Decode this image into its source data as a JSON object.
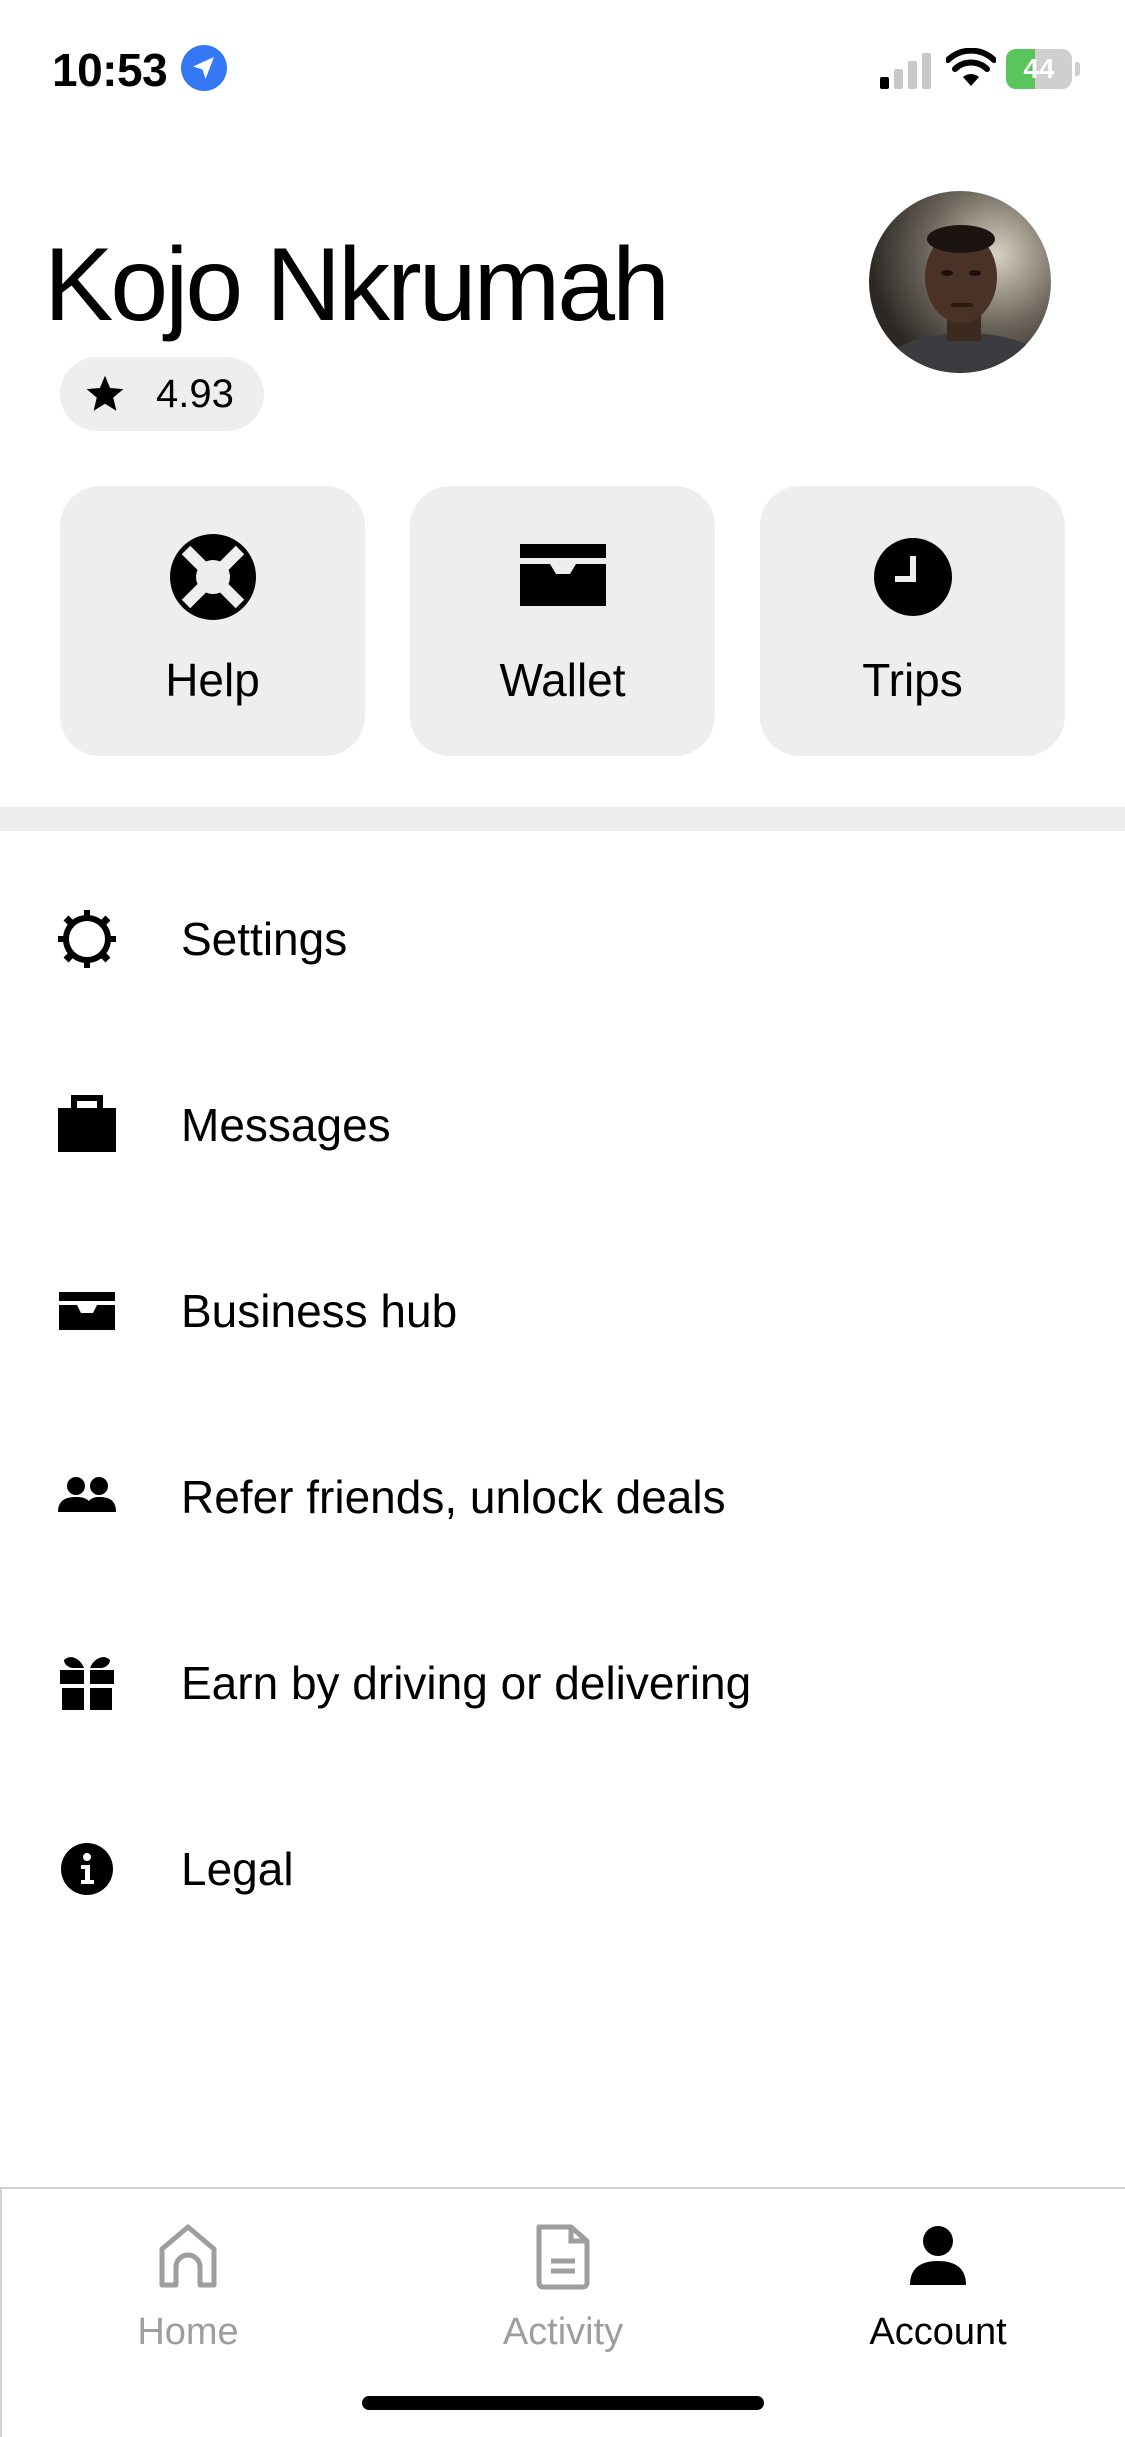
{
  "status_bar": {
    "time": "10:53",
    "battery_level": "44",
    "battery_fraction": 0.44
  },
  "profile": {
    "name": "Kojo Nkrumah",
    "rating": "4.93"
  },
  "quick_actions": [
    {
      "label": "Help",
      "icon": "lifebuoy-icon"
    },
    {
      "label": "Wallet",
      "icon": "wallet-icon"
    },
    {
      "label": "Trips",
      "icon": "clock-icon"
    }
  ],
  "menu": [
    {
      "label": "Settings",
      "icon": "gear-icon"
    },
    {
      "label": "Messages",
      "icon": "briefcase-icon"
    },
    {
      "label": "Business hub",
      "icon": "tray-icon"
    },
    {
      "label": "Refer friends, unlock deals",
      "icon": "people-icon"
    },
    {
      "label": "Earn by driving or delivering",
      "icon": "gift-icon"
    },
    {
      "label": "Legal",
      "icon": "info-icon"
    }
  ],
  "tabs": [
    {
      "label": "Home",
      "icon": "home-icon",
      "active": false
    },
    {
      "label": "Activity",
      "icon": "activity-icon",
      "active": false
    },
    {
      "label": "Account",
      "icon": "account-icon",
      "active": true
    }
  ],
  "colors": {
    "tile_background": "#eeeeee",
    "location_blue": "#3478f6",
    "battery_green": "#5ac55a",
    "inactive_tab": "#9e9e9e"
  }
}
